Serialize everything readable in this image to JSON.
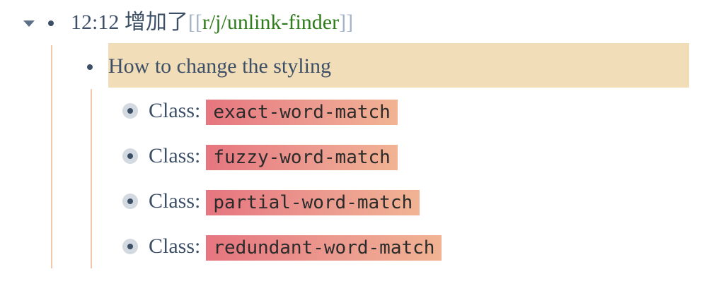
{
  "block": {
    "time_text": "12:12 增加了",
    "bracket_open": "[[",
    "link_text": "r/j/unlink-finder",
    "bracket_close": "]]"
  },
  "child": {
    "text": "How to change the styling"
  },
  "items": [
    {
      "prefix": "Class:",
      "code": "exact-word-match"
    },
    {
      "prefix": "Class:",
      "code": "fuzzy-word-match"
    },
    {
      "prefix": "Class:",
      "code": "partial-word-match"
    },
    {
      "prefix": "Class:",
      "code": "redundant-word-match"
    }
  ],
  "colors": {
    "highlight": "#f1deb9",
    "link": "#2e7d1a",
    "code_gradient_start": "#e6757f",
    "code_gradient_end": "#f1b393"
  }
}
